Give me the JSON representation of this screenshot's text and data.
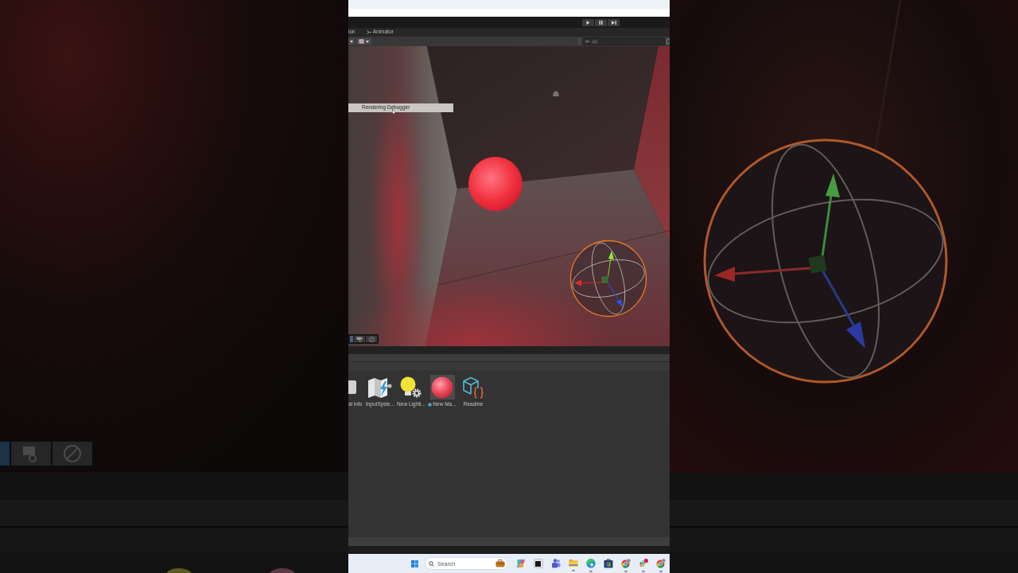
{
  "play_controls": [
    {
      "kind": "play"
    },
    {
      "kind": "pause"
    },
    {
      "kind": "step"
    }
  ],
  "tabs": [
    {
      "label": "ion",
      "kind": "plain",
      "selected": false
    },
    {
      "label": "Animator",
      "kind": "animator",
      "selected": false
    }
  ],
  "search": {
    "placeholder": "All"
  },
  "scene": {
    "menu_items": [
      {
        "label": "Rendering Debugger",
        "selected": true
      }
    ],
    "overlay_buttons": [
      {
        "kind": "partial",
        "selected": true
      },
      {
        "kind": "camera",
        "selected": false
      },
      {
        "kind": "orbit",
        "selected": false
      }
    ]
  },
  "project": {
    "assets": [
      {
        "label": "al info",
        "kind": "partial",
        "selected": false
      },
      {
        "label": "InputSyste...",
        "kind": "input_actions",
        "selected": false
      },
      {
        "label": "New Lighti...",
        "kind": "lighting",
        "selected": false
      },
      {
        "label": "New Ma...",
        "kind": "material",
        "selected": true
      },
      {
        "label": "Readme",
        "kind": "readme",
        "selected": false
      }
    ]
  },
  "taskbar": {
    "search": {
      "placeholder": "Search"
    },
    "apps": [
      {
        "kind": "assistant",
        "running": false
      },
      {
        "kind": "window",
        "running": false
      },
      {
        "kind": "chat",
        "running": false
      },
      {
        "kind": "folder",
        "running": true
      },
      {
        "kind": "browser",
        "running": true
      },
      {
        "kind": "store",
        "running": false
      },
      {
        "kind": "round_logo",
        "running": true
      },
      {
        "kind": "messaging",
        "running": true
      },
      {
        "kind": "round_logo",
        "running": true
      }
    ]
  }
}
